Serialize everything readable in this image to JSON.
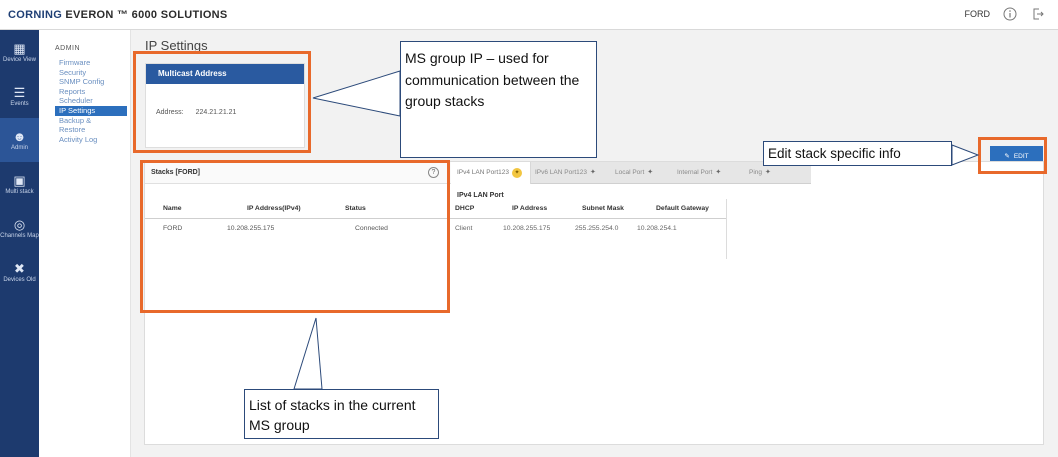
{
  "header": {
    "brand_primary": "CORNING",
    "brand_secondary": "EVERON ™ 6000 SOLUTIONS",
    "user_label": "FORD",
    "info_icon": "info-icon",
    "logout_icon": "logout-icon"
  },
  "sidebar": {
    "items": [
      {
        "label": "Device View",
        "icon": "grid-icon"
      },
      {
        "label": "Events",
        "icon": "list-icon"
      },
      {
        "label": "Admin",
        "icon": "person-icon"
      },
      {
        "label": "Multi stack",
        "icon": "stack-icon"
      },
      {
        "label": "Channels Map",
        "icon": "target-icon"
      },
      {
        "label": "Devices Old",
        "icon": "tools-icon"
      }
    ]
  },
  "submenu": {
    "heading": "ADMIN",
    "items": [
      "Firmware",
      "Security",
      "SNMP Config",
      "Reports",
      "Scheduler",
      "IP Settings",
      "Backup &",
      "Restore",
      "Activity Log"
    ]
  },
  "main": {
    "title": "IP Settings",
    "multicast": {
      "header": "Multicast Address",
      "address_label": "Address:",
      "address_value": "224.21.21.21"
    },
    "edit_button": "EDIT",
    "stacks": {
      "title": "Stacks [FORD]",
      "columns": [
        "Name",
        "IP Address(IPv4)",
        "Status"
      ],
      "rows": [
        {
          "name": "FORD",
          "ip": "10.208.255.175",
          "status": "Connected"
        }
      ]
    },
    "tabs": [
      "IPv4 LAN Port123",
      "IPv6 LAN Port123",
      "Local Port",
      "Internal Port",
      "Ping"
    ],
    "lan": {
      "title": "IPv4 LAN Port",
      "columns": [
        "DHCP",
        "IP Address",
        "Subnet Mask",
        "Default Gateway"
      ],
      "rows": [
        {
          "dhcp": "Client",
          "ip": "10.208.255.175",
          "subnet": "255.255.254.0",
          "gateway": "10.208.254.1"
        }
      ]
    }
  },
  "annotations": {
    "multicast_note": "MS group IP – used for communication between the group stacks",
    "edit_note": "Edit stack specific info",
    "stacks_note": "List of stacks in the current MS group"
  }
}
